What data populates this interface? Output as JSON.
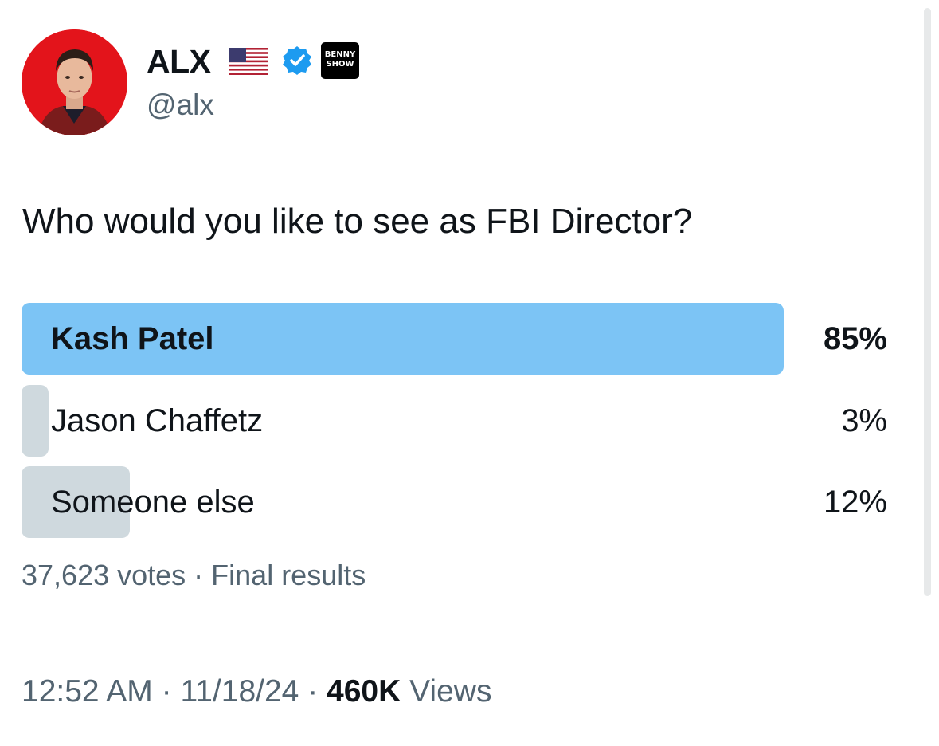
{
  "author": {
    "display_name": "ALX",
    "handle": "@alx",
    "flag_icon": "us-flag-icon",
    "verified_icon": "verified-badge-icon",
    "verified_color": "#1d9bf0",
    "affiliation_badge": {
      "line1": "BENNY",
      "line2": "SHOW"
    }
  },
  "tweet": {
    "text": "Who would you like to see as FBI Director?"
  },
  "poll": {
    "options": [
      {
        "label": "Kash Patel",
        "percent_text": "85%",
        "percent": 85,
        "winner": true
      },
      {
        "label": "Jason Chaffetz",
        "percent_text": "3%",
        "percent": 3,
        "winner": false
      },
      {
        "label": "Someone else",
        "percent_text": "12%",
        "percent": 12,
        "winner": false
      }
    ],
    "votes": "37,623 votes",
    "separator": " · ",
    "status": "Final results",
    "winner_color": "#7cc4f5",
    "other_color": "#cfd9de"
  },
  "meta": {
    "time": "12:52 AM",
    "date": "11/18/24",
    "separator": " · ",
    "views_count": "460K",
    "views_label": " Views"
  }
}
